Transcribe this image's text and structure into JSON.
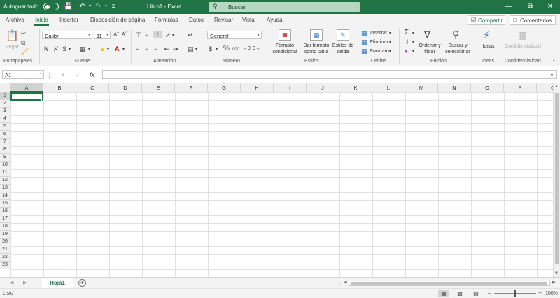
{
  "titlebar": {
    "autosave_label": "Autoguardado",
    "autosave_state": "off",
    "title": "Libro1  -  Excel",
    "search_placeholder": "Buscar",
    "icons": [
      "save-icon",
      "undo-icon",
      "redo-icon",
      "customize-qat-icon",
      "minimize-icon",
      "restore-icon",
      "close-icon"
    ]
  },
  "tabs": [
    "Archivo",
    "Inicio",
    "Insertar",
    "Disposición de página",
    "Fórmulas",
    "Datos",
    "Revisar",
    "Vista",
    "Ayuda"
  ],
  "active_tab": "Inicio",
  "share_label": "Compartir",
  "comments_label": "Comentarios",
  "ribbon": {
    "clipboard": {
      "label": "Portapapeles",
      "paste": "Pegar"
    },
    "font": {
      "label": "Fuente",
      "font_name": "Calibri",
      "font_size": "11",
      "bold": "N",
      "italic": "K",
      "underline": "S"
    },
    "alignment": {
      "label": "Alineación"
    },
    "number": {
      "label": "Número",
      "format": "General",
      "percent": "%",
      "thousands": "000"
    },
    "styles": {
      "label": "Estilos",
      "conditional_line1": "Formato",
      "conditional_line2": "condicional",
      "table_line1": "Dar formato",
      "table_line2": "como tabla",
      "cell_styles_line1": "Estilos de",
      "cell_styles_line2": "celda"
    },
    "cells": {
      "label": "Celdas",
      "insert": "Insertar",
      "delete": "Eliminar",
      "format": "Formato"
    },
    "editing": {
      "label": "Edición",
      "sort_line1": "Ordenar y",
      "sort_line2": "filtrar",
      "find_line1": "Buscar y",
      "find_line2": "seleccionar"
    },
    "ideas": {
      "label": "Ideas",
      "button": "Ideas"
    },
    "confidentiality": {
      "label": "Confidencialidad",
      "button": "Confidencialidad"
    }
  },
  "formula_bar": {
    "name_box": "A1",
    "fx": "fx",
    "value": ""
  },
  "columns": [
    "A",
    "B",
    "C",
    "D",
    "E",
    "F",
    "G",
    "H",
    "I",
    "J",
    "K",
    "L",
    "M",
    "N",
    "O",
    "P",
    "Q"
  ],
  "rows": [
    "1",
    "2",
    "3",
    "4",
    "5",
    "6",
    "7",
    "8",
    "9",
    "10",
    "11",
    "12",
    "13",
    "14",
    "15",
    "16",
    "17",
    "18",
    "19",
    "20",
    "21",
    "22",
    "23"
  ],
  "active_cell": "A1",
  "sheet_tabs": [
    "Hoja1"
  ],
  "status": {
    "text": "Listo",
    "zoom": "100%"
  },
  "colors": {
    "accent": "#217346",
    "ribbon_bg": "#f3f3f3",
    "grid_line": "#e1e1e1"
  }
}
